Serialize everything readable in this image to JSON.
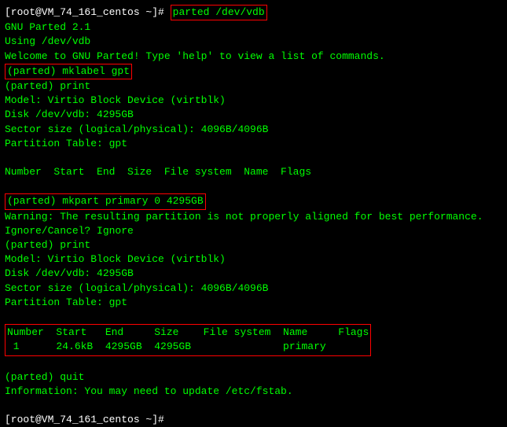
{
  "prompt1": "[root@VM_74_161_centos ~]# ",
  "cmd1": "parted /dev/vdb",
  "intro": {
    "l1": "GNU Parted 2.1",
    "l2": "Using /dev/vdb",
    "l3": "Welcome to GNU Parted! Type 'help' to view a list of commands."
  },
  "mklabel": "(parted) mklabel gpt",
  "print1": "(parted) print",
  "model": "Model: Virtio Block Device (virtblk)",
  "disk": "Disk /dev/vdb: 4295GB",
  "sector": "Sector size (logical/physical): 4096B/4096B",
  "ptable": "Partition Table: gpt",
  "header1": "Number  Start  End  Size  File system  Name  Flags",
  "mkpart": "(parted) mkpart primary 0 4295GB",
  "warning": "Warning: The resulting partition is not properly aligned for best performance.",
  "ignore": "Ignore/Cancel? Ignore",
  "print2": "(parted) print",
  "header2": "Number  Start   End     Size    File system  Name     Flags",
  "row1": " 1      24.6kB  4295GB  4295GB               primary",
  "quit": "(parted) quit",
  "info": "Information: You may need to update /etc/fstab.",
  "prompt2": "[root@VM_74_161_centos ~]# "
}
